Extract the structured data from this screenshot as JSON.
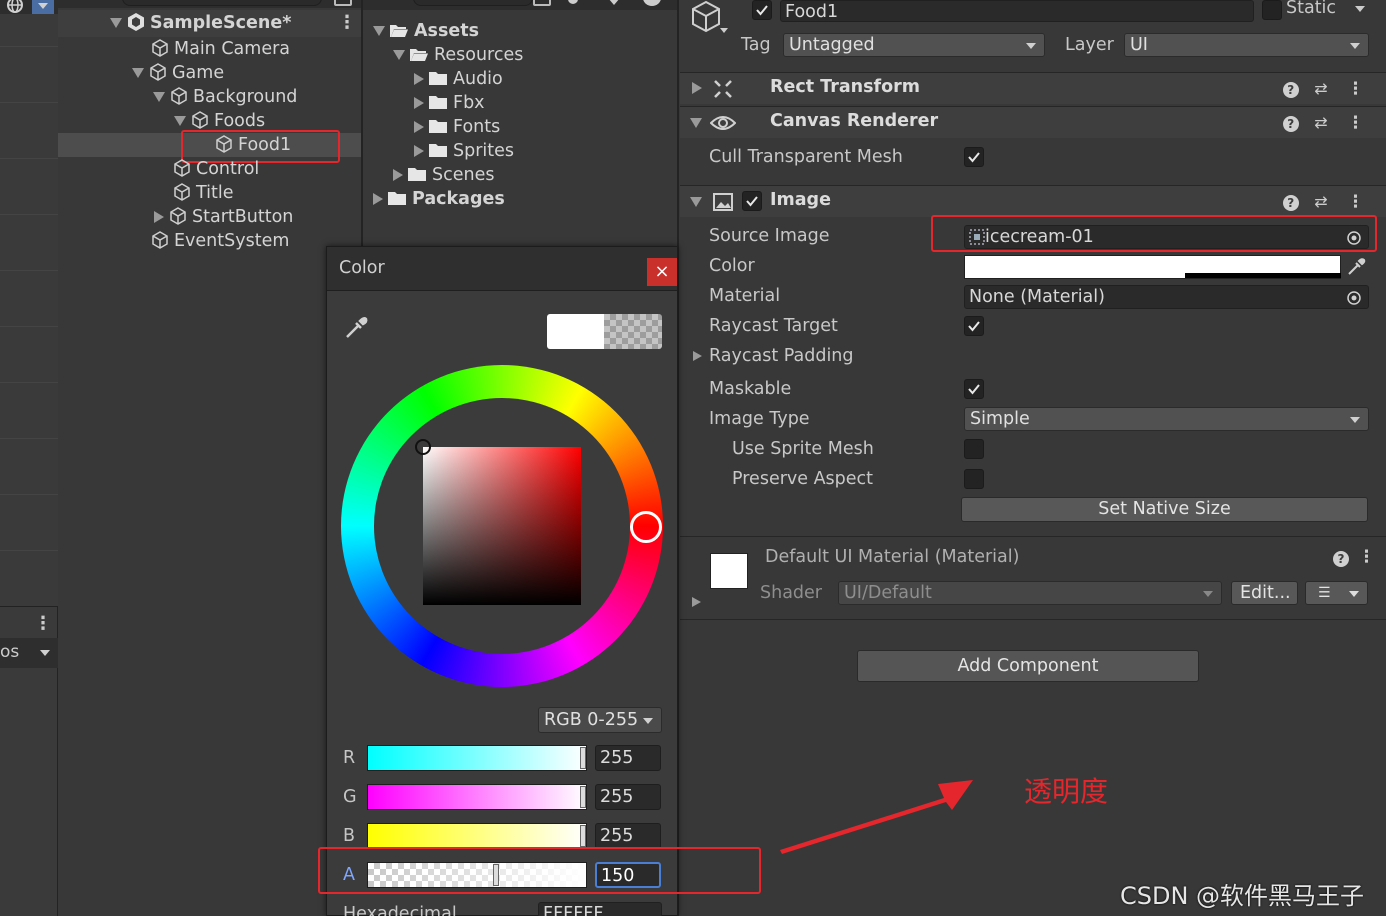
{
  "hierarchy": {
    "scene": "SampleScene*",
    "items": [
      "Main Camera",
      "Game",
      "Background",
      "Foods",
      "Food1",
      "Control",
      "Title",
      "StartButton",
      "EventSystem"
    ]
  },
  "left_strip": {
    "label": "os"
  },
  "project": {
    "items": [
      "Assets",
      "Resources",
      "Audio",
      "Fbx",
      "Fonts",
      "Sprites",
      "Scenes",
      "Packages"
    ]
  },
  "inspector": {
    "object_name": "Food1",
    "static_label": "Static",
    "tag_label": "Tag",
    "tag_value": "Untagged",
    "layer_label": "Layer",
    "layer_value": "UI",
    "rect_transform": "Rect Transform",
    "canvas_renderer": "Canvas Renderer",
    "cull_transparent_mesh": "Cull Transparent Mesh",
    "image": "Image",
    "source_image_label": "Source Image",
    "source_image_value": "icecream-01",
    "color_label": "Color",
    "material_label": "Material",
    "material_value": "None (Material)",
    "raycast_target": "Raycast Target",
    "raycast_padding": "Raycast Padding",
    "maskable": "Maskable",
    "image_type_label": "Image Type",
    "image_type_value": "Simple",
    "use_sprite_mesh": "Use Sprite Mesh",
    "preserve_aspect": "Preserve Aspect",
    "set_native_size": "Set Native Size",
    "material_name": "Default UI Material (Material)",
    "shader_label": "Shader",
    "shader_value": "UI/Default",
    "edit_button": "Edit...",
    "add_component": "Add Component"
  },
  "color_picker": {
    "title": "Color",
    "close": "×",
    "mode": "RGB 0-255",
    "channels": [
      {
        "label": "R",
        "value": "255"
      },
      {
        "label": "G",
        "value": "255"
      },
      {
        "label": "B",
        "value": "255"
      },
      {
        "label": "A",
        "value": "150"
      }
    ],
    "alpha_fraction": 0.59,
    "hex_label": "Hexadecimal",
    "hex_value": "FFFFFF"
  },
  "annotation": {
    "text": "透明度",
    "color": "#e5262c"
  },
  "watermark": "CSDN @软件黑马王子"
}
